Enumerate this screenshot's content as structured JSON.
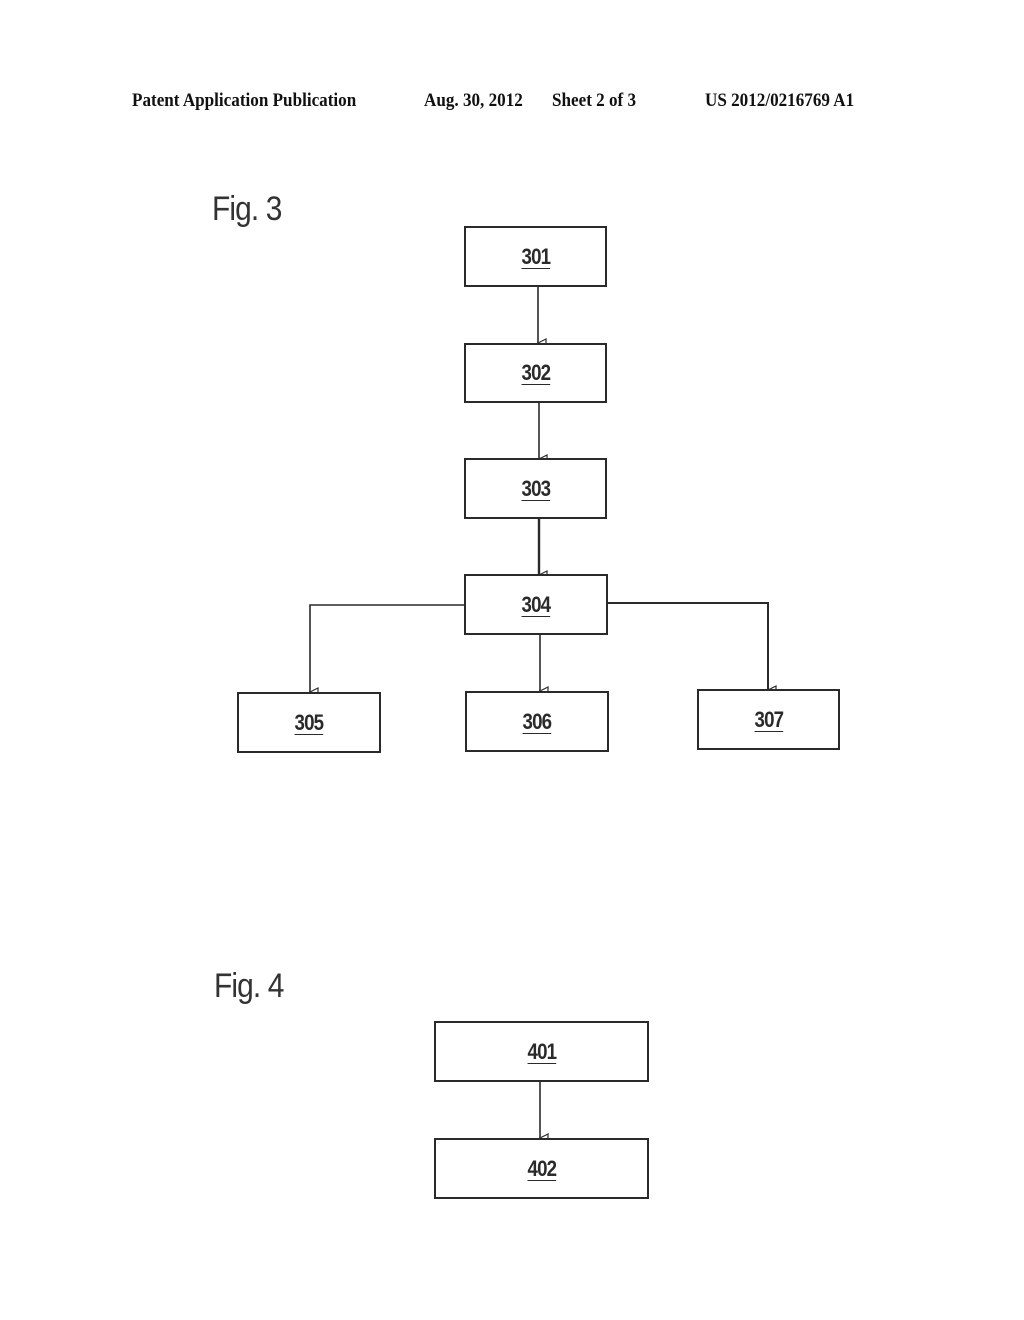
{
  "header": {
    "publication": "Patent Application Publication",
    "date": "Aug. 30, 2012",
    "sheet": "Sheet 2 of 3",
    "number": "US 2012/0216769 A1"
  },
  "figures": [
    {
      "title": "Fig. 3",
      "nodes": [
        "301",
        "302",
        "303",
        "304",
        "305",
        "306",
        "307"
      ],
      "edges": [
        [
          "301",
          "302"
        ],
        [
          "302",
          "303"
        ],
        [
          "303",
          "304"
        ],
        [
          "304",
          "305"
        ],
        [
          "304",
          "306"
        ],
        [
          "304",
          "307"
        ]
      ]
    },
    {
      "title": "Fig. 4",
      "nodes": [
        "401",
        "402"
      ],
      "edges": [
        [
          "401",
          "402"
        ]
      ]
    }
  ]
}
